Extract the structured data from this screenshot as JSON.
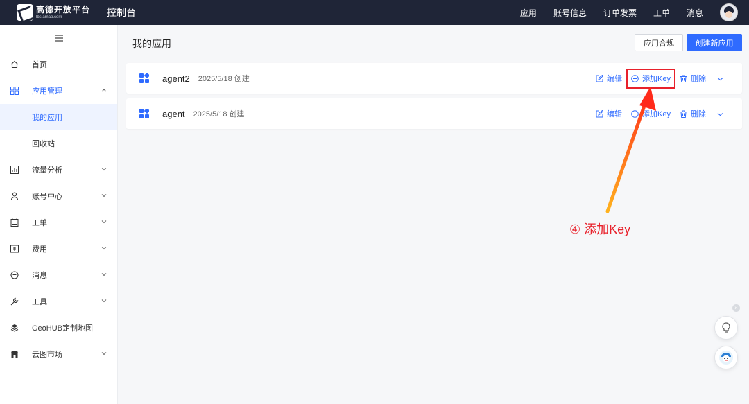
{
  "header": {
    "logo_title": "高德开放平台",
    "logo_subtitle": "lbs.amap.com",
    "console": "控制台",
    "nav": [
      {
        "label": "应用"
      },
      {
        "label": "账号信息"
      },
      {
        "label": "订单发票"
      },
      {
        "label": "工单"
      },
      {
        "label": "消息"
      }
    ]
  },
  "sidebar": {
    "toggle_icon": "menu-icon",
    "items": [
      {
        "label": "首页",
        "icon": "home-icon",
        "has_chevron": false
      },
      {
        "label": "应用管理",
        "icon": "grid-icon",
        "has_chevron": true,
        "expanded": true,
        "children": [
          {
            "label": "我的应用",
            "selected": true
          },
          {
            "label": "回收站",
            "selected": false
          }
        ]
      },
      {
        "label": "流量分析",
        "icon": "chart-icon",
        "has_chevron": true
      },
      {
        "label": "账号中心",
        "icon": "user-icon",
        "has_chevron": true
      },
      {
        "label": "工单",
        "icon": "ticket-icon",
        "has_chevron": true
      },
      {
        "label": "费用",
        "icon": "billing-icon",
        "has_chevron": true
      },
      {
        "label": "消息",
        "icon": "message-icon",
        "has_chevron": true
      },
      {
        "label": "工具",
        "icon": "wrench-icon",
        "has_chevron": true
      },
      {
        "label": "GeoHUB定制地图",
        "icon": "layers-icon",
        "has_chevron": false
      },
      {
        "label": "云图市场",
        "icon": "store-icon",
        "has_chevron": true
      }
    ]
  },
  "main": {
    "title": "我的应用",
    "btn_compliance": "应用合规",
    "btn_create": "创建新应用",
    "apps": [
      {
        "name": "agent2",
        "date": "2025/5/18 创建",
        "edit": "编辑",
        "add_key": "添加Key",
        "delete": "删除",
        "highlighted": true
      },
      {
        "name": "agent",
        "date": "2025/5/18 创建",
        "edit": "编辑",
        "add_key": "添加Key",
        "delete": "删除",
        "highlighted": false
      }
    ]
  },
  "annotation": {
    "text": "④ 添加Key",
    "color": "#e8212b"
  },
  "floating": {
    "close": "×",
    "buttons": [
      "lightbulb-icon",
      "assistant-icon"
    ]
  },
  "colors": {
    "topbar": "#1f2537",
    "accent": "#2f6bff",
    "annotation": "#e8212b"
  }
}
